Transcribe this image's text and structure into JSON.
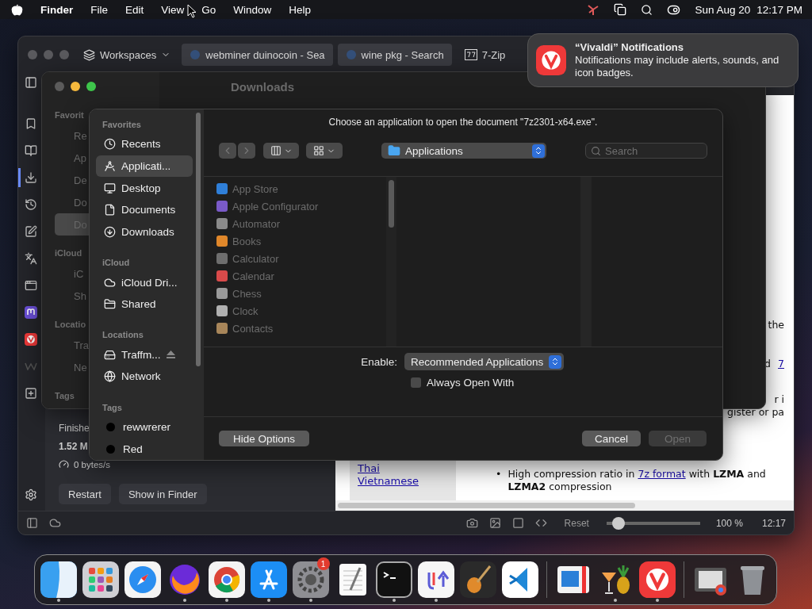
{
  "menubar": {
    "app": "Finder",
    "menus": [
      "File",
      "Edit",
      "View",
      "Go",
      "Window",
      "Help"
    ],
    "date": "Sun Aug 20",
    "time": "12:17 PM"
  },
  "notification": {
    "title": "“Vivaldi” Notifications",
    "body": "Notifications may include alerts, sounds, and icon badges."
  },
  "browser": {
    "workspaces": "Workspaces",
    "tabs": [
      {
        "title": "webminer duinocoin - Sea",
        "selected": false
      },
      {
        "title": "wine pkg - Search",
        "selected": false
      },
      {
        "title": "7-Zip",
        "selected": true
      }
    ],
    "panels": [
      {
        "kind": "bookmarks",
        "selected": false
      },
      {
        "kind": "reader",
        "selected": false
      },
      {
        "kind": "downloads",
        "selected": true
      },
      {
        "kind": "history",
        "selected": false
      },
      {
        "kind": "notes",
        "selected": false
      },
      {
        "kind": "translate",
        "selected": false
      },
      {
        "kind": "window",
        "selected": false
      },
      {
        "kind": "mastodon",
        "selected": false
      },
      {
        "kind": "vivaldi",
        "selected": false
      },
      {
        "kind": "wiki",
        "selected": false
      },
      {
        "kind": "add",
        "selected": false
      }
    ],
    "downloads": {
      "status": "Finishe",
      "size": "1.52 M",
      "speed": "0 bytes/s",
      "buttons": [
        "Restart",
        "Show in Finder"
      ]
    },
    "page": {
      "lines": [
        {
          "parts": [
            {
              "kind": "text",
              "text": "the"
            }
          ]
        },
        {
          "parts": [
            {
              "kind": "text",
              "text": "d"
            },
            {
              "kind": "link",
              "text": "7"
            }
          ]
        },
        {
          "parts": [
            {
              "kind": "text",
              "text": "r i"
            }
          ]
        },
        {
          "parts": [
            {
              "kind": "text",
              "text": "gister or pa"
            }
          ]
        }
      ],
      "languages": [
        "Thai",
        "Vietnamese"
      ],
      "features": [
        {
          "bullet": "•",
          "before": "High compression ratio in ",
          "link": "7z format",
          "after": " with **LZMA** and **LZMA2** compression"
        }
      ]
    },
    "status_bar": {
      "reset": "Reset",
      "zoom_slider": {
        "level": 0.13
      },
      "zoom": "100 %",
      "clock": "12:17"
    }
  },
  "finder": {
    "title": "Downloads",
    "sidebar": [
      {
        "kind": "heading",
        "text": "Favorit",
        "selected": false
      },
      {
        "kind": "item",
        "text": "Re",
        "selected": false
      },
      {
        "kind": "item",
        "text": "Ap",
        "selected": false
      },
      {
        "kind": "item",
        "text": "De",
        "selected": false
      },
      {
        "kind": "item",
        "text": "Do",
        "selected": false
      },
      {
        "kind": "item",
        "text": "Do",
        "selected": true
      },
      {
        "kind": "heading",
        "text": "iCloud",
        "selected": false
      },
      {
        "kind": "item",
        "text": "iC",
        "selected": false
      },
      {
        "kind": "item",
        "text": "Sh",
        "selected": false
      },
      {
        "kind": "heading",
        "text": "Locatio",
        "selected": false
      },
      {
        "kind": "item",
        "text": "Tra",
        "selected": false
      },
      {
        "kind": "item",
        "text": "Ne",
        "selected": false
      },
      {
        "kind": "heading",
        "text": "Tags",
        "selected": false
      }
    ]
  },
  "dialog": {
    "prompt": "Choose an application to open the document \"7z2301-x64.exe\".",
    "sidebar": [
      {
        "heading": "Favorites",
        "items": [
          {
            "kind": "recents",
            "label": "Recents",
            "selected": false
          },
          {
            "kind": "apps",
            "label": "Applicati...",
            "selected": true
          },
          {
            "kind": "desktop",
            "label": "Desktop",
            "selected": false
          },
          {
            "kind": "document",
            "label": "Documents",
            "selected": false
          },
          {
            "kind": "download",
            "label": "Downloads",
            "selected": false
          }
        ]
      },
      {
        "heading": "iCloud",
        "items": [
          {
            "kind": "cloud",
            "label": "iCloud Dri...",
            "selected": false
          },
          {
            "kind": "shared",
            "label": "Shared",
            "selected": false
          }
        ]
      },
      {
        "heading": "Locations",
        "items": [
          {
            "kind": "drive",
            "label": "Traffm...",
            "selected": false
          },
          {
            "kind": "network",
            "label": "Network",
            "selected": false
          }
        ]
      },
      {
        "heading": "Tags",
        "items": [
          {
            "kind": "tag",
            "label": "rewwrerer",
            "selected": false
          },
          {
            "kind": "tag",
            "label": "Red",
            "selected": false
          }
        ]
      }
    ],
    "location": "Applications",
    "search": {
      "placeholder": "Search"
    },
    "apps": [
      {
        "name": "App Store",
        "color": "#2f7fd8",
        "disabled": true
      },
      {
        "name": "Apple Configurator",
        "color": "#7a5ac8",
        "disabled": true
      },
      {
        "name": "Automator",
        "color": "#8a8a8a",
        "disabled": true
      },
      {
        "name": "Books",
        "color": "#e0872a",
        "disabled": true
      },
      {
        "name": "Calculator",
        "color": "#6e6e6e",
        "disabled": true
      },
      {
        "name": "Calendar",
        "color": "#d94a4a",
        "disabled": true
      },
      {
        "name": "Chess",
        "color": "#9a9a9a",
        "disabled": true
      },
      {
        "name": "Clock",
        "color": "#b0b0b0",
        "disabled": true
      },
      {
        "name": "Contacts",
        "color": "#a8865a",
        "disabled": true
      }
    ],
    "enable_label": "Enable:",
    "enable_value": "Recommended Applications",
    "always_open": {
      "label": "Always Open With",
      "checked": false
    },
    "hide_options": "Hide Options",
    "cancel": "Cancel",
    "open": {
      "label": "Open",
      "disabled": true
    }
  },
  "dock": [
    {
      "running": true
    },
    {
      "running": false
    },
    {
      "running": false
    },
    {
      "running": true
    },
    {
      "running": true
    },
    {
      "running": true
    },
    {
      "running": true,
      "badge": "1"
    },
    {
      "running": false
    },
    {
      "running": true
    },
    {
      "running": true
    },
    {
      "running": false
    },
    {
      "running": false
    },
    {
      "running": false
    },
    {
      "running": true
    },
    {
      "running": true
    },
    {
      "running": false
    },
    {
      "running": false
    }
  ]
}
